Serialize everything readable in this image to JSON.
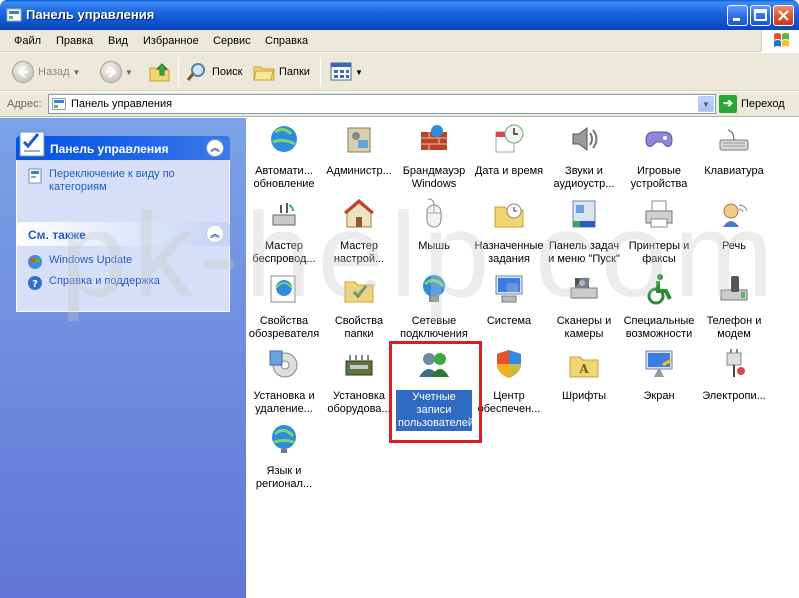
{
  "window": {
    "title": "Панель управления"
  },
  "menu": [
    "Файл",
    "Правка",
    "Вид",
    "Избранное",
    "Сервис",
    "Справка"
  ],
  "toolbar": {
    "back": "Назад",
    "search": "Поиск",
    "folders": "Папки"
  },
  "address": {
    "label": "Адрес:",
    "value": "Панель управления",
    "go": "Переход"
  },
  "sidebar": {
    "panel1": {
      "title": "Панель управления",
      "link": "Переключение к виду по категориям"
    },
    "panel2": {
      "title": "См. также",
      "links": [
        "Windows Update",
        "Справка и поддержка"
      ]
    }
  },
  "items": [
    "Автомати... обновление",
    "Администр...",
    "Брандмауэр Windows",
    "Дата и время",
    "Звуки и аудиоустр...",
    "Игровые устройства",
    "Клавиатура",
    "Мастер беспровод...",
    "Мастер настрой...",
    "Мышь",
    "Назначенные задания",
    "Панель задач и меню \"Пуск\"",
    "Принтеры и факсы",
    "Речь",
    "Свойства обозревателя",
    "Свойства папки",
    "Сетевые подключения",
    "Система",
    "Сканеры и камеры",
    "Специальные возможности",
    "Телефон и модем",
    "Установка и удаление...",
    "Установка оборудова...",
    "Учетные записи пользователей",
    "Центр обеспечен...",
    "Шрифты",
    "Экран",
    "Электропи...",
    "Язык и регионал..."
  ],
  "watermark": "pk-help.com",
  "colors": {
    "selection": "#316ac5",
    "highlight_box": "#e01b24",
    "link": "#215dc6"
  }
}
